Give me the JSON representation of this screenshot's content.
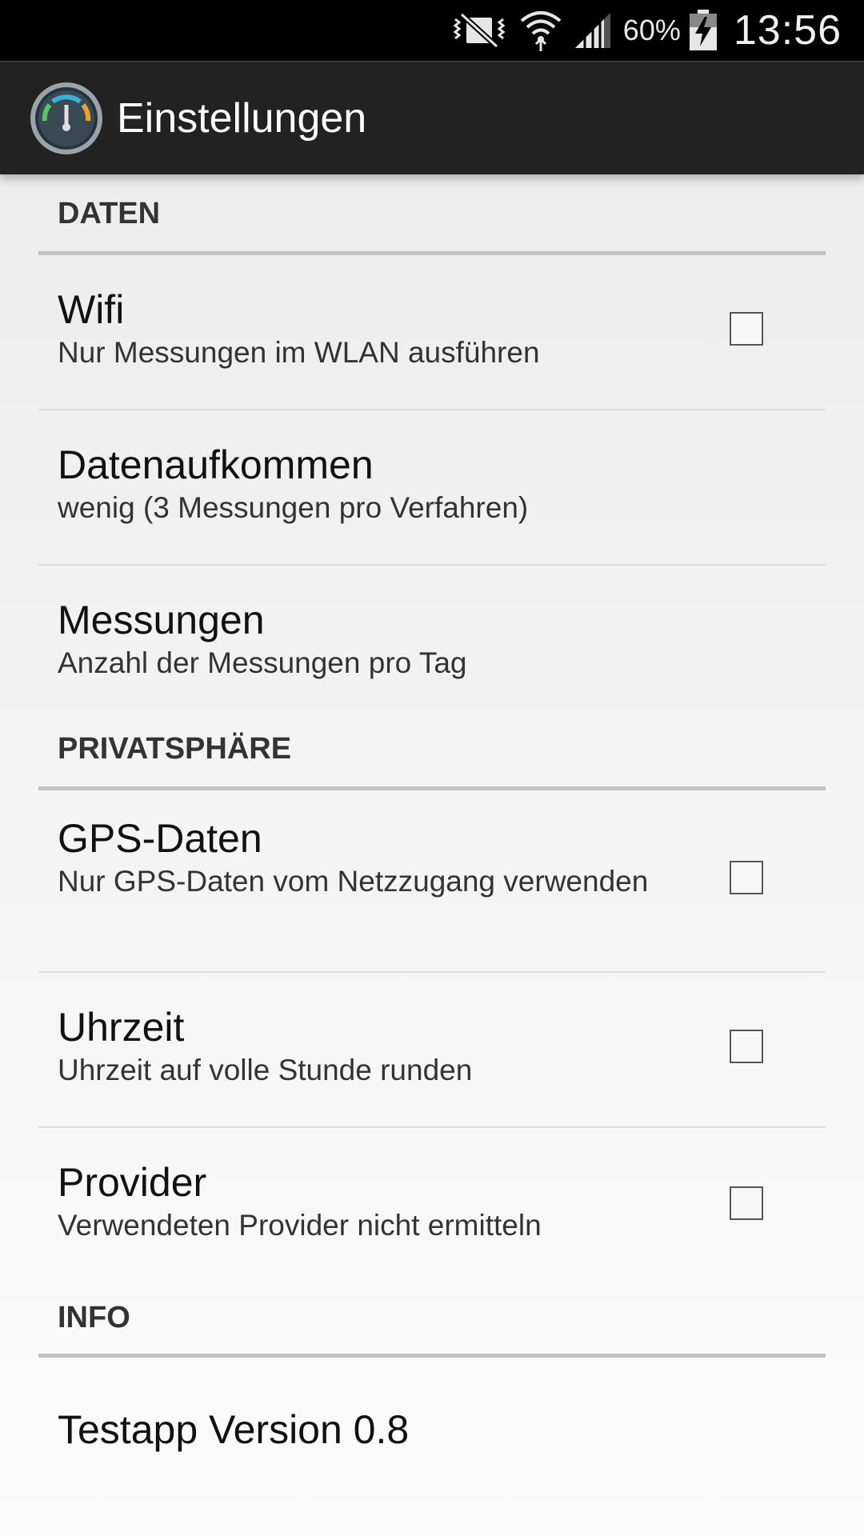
{
  "status_bar": {
    "battery_percent": "60%",
    "time": "13:56",
    "icons": [
      "vibrate-mute-icon",
      "wifi-icon",
      "signal-icon",
      "battery-charging-icon"
    ]
  },
  "action_bar": {
    "title": "Einstellungen",
    "icon": "speedometer-icon"
  },
  "sections": {
    "daten": {
      "header": "DATEN",
      "items": [
        {
          "title": "Wifi",
          "summary": "Nur Messungen im WLAN ausführen",
          "checked": false
        },
        {
          "title": "Datenaufkommen",
          "summary": "wenig (3 Messungen pro Verfahren)"
        },
        {
          "title": "Messungen",
          "summary": "Anzahl der Messungen pro Tag"
        }
      ]
    },
    "privatsphaere": {
      "header": "PRIVATSPHÄRE",
      "items": [
        {
          "title": "GPS-Daten",
          "summary": "Nur GPS-Daten vom Netzzugang verwenden",
          "checked": false
        },
        {
          "title": "Uhrzeit",
          "summary": "Uhrzeit auf volle Stunde runden",
          "checked": false
        },
        {
          "title": "Provider",
          "summary": "Verwendeten Provider nicht ermitteln",
          "checked": false
        }
      ]
    },
    "info": {
      "header": "INFO",
      "items": [
        {
          "title": "Testapp Version 0.8"
        }
      ]
    }
  },
  "colors": {
    "status_bar": "#000000",
    "action_bar": "#222222",
    "section_divider": "#c2c2c2",
    "item_divider": "#dddddd"
  }
}
